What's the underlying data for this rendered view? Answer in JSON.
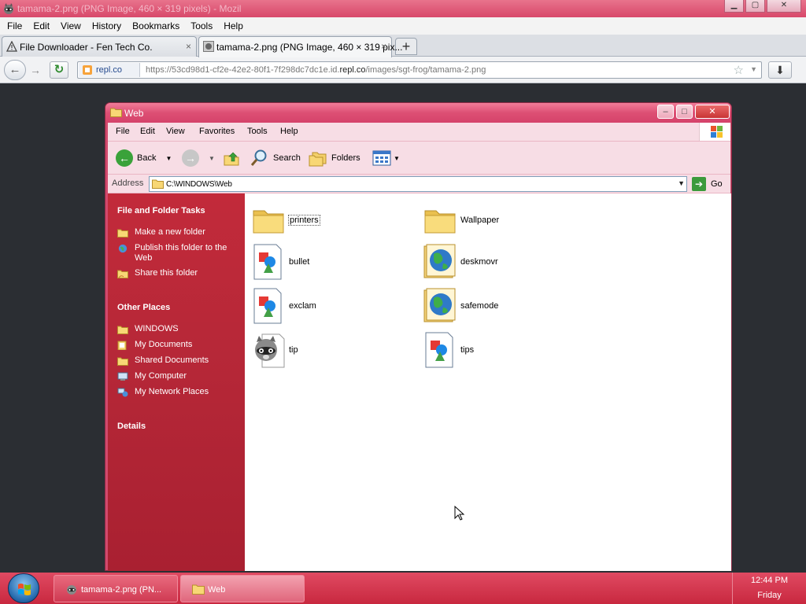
{
  "firefox": {
    "title": "tamama-2.png (PNG Image, 460 × 319 pixels) - Mozil",
    "menu": [
      "File",
      "Edit",
      "View",
      "History",
      "Bookmarks",
      "Tools",
      "Help"
    ],
    "tabs": [
      {
        "label": "File Downloader - Fen Tech Co.",
        "close": "×"
      },
      {
        "label": "tamama-2.png (PNG Image, 460 × 319 pix...",
        "close": "×"
      }
    ],
    "new_tab": "+",
    "site_identity": "repl.co",
    "url_prefix": "https://53cd98d1-cf2e-42e2-80f1-7f298dc7dc1e.id.",
    "url_domain": "repl.co",
    "url_suffix": "/images/sgt-frog/tamama-2.png"
  },
  "explorer": {
    "title": "Web",
    "menu": [
      "File",
      "Edit",
      "View",
      "Favorites",
      "Tools",
      "Help"
    ],
    "toolbar": {
      "back": "Back",
      "search": "Search",
      "folders": "Folders"
    },
    "address_label": "Address",
    "address_value": "C:\\WINDOWS\\Web",
    "go_label": "Go",
    "sidebar": {
      "tasks_title": "File and Folder Tasks",
      "tasks": [
        "Make a new folder",
        "Publish this folder to the Web",
        "Share this folder"
      ],
      "places_title": "Other Places",
      "places": [
        "WINDOWS",
        "My Documents",
        "Shared Documents",
        "My Computer",
        "My Network Places"
      ],
      "details_title": "Details"
    },
    "files": [
      {
        "name": "printers",
        "icon": "folder-icon"
      },
      {
        "name": "Wallpaper",
        "icon": "folder-icon"
      },
      {
        "name": "bullet",
        "icon": "image-file-icon"
      },
      {
        "name": "deskmovr",
        "icon": "web-page-icon"
      },
      {
        "name": "exclam",
        "icon": "image-file-icon"
      },
      {
        "name": "safemode",
        "icon": "web-page-icon"
      },
      {
        "name": "tip",
        "icon": "raccoon-image-icon"
      },
      {
        "name": "tips",
        "icon": "image-file-icon"
      }
    ]
  },
  "taskbar": {
    "buttons": [
      "tamama-2.png (PN...",
      "Web"
    ],
    "clock": "12:44 PM",
    "day": "Friday"
  }
}
